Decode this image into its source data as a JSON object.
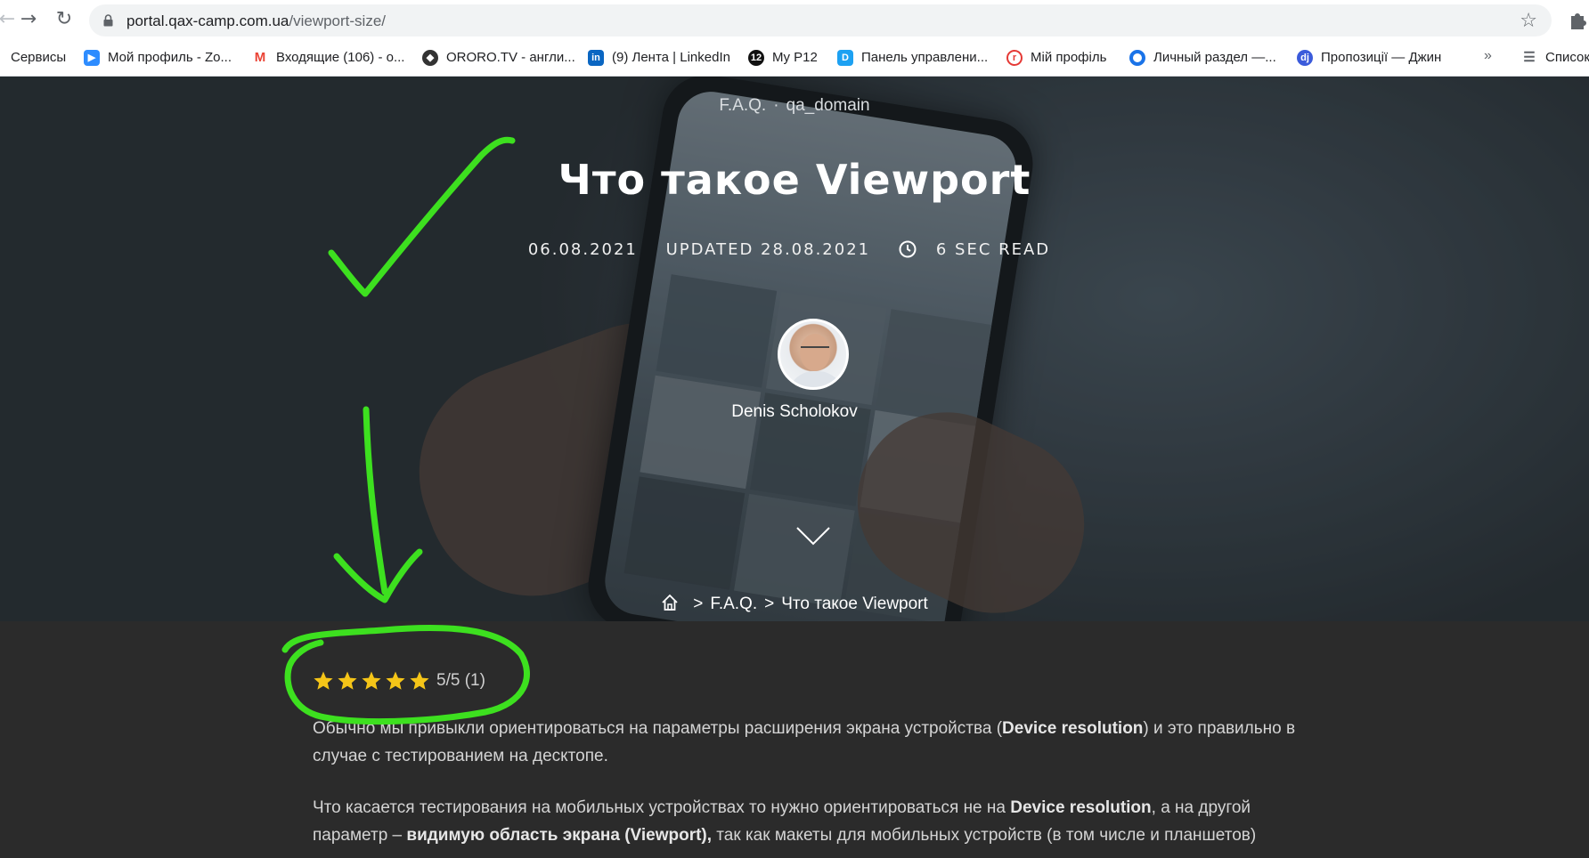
{
  "browser": {
    "url_domain": "portal.qax-camp.com.ua",
    "url_path": "/viewport-size/",
    "bookmarks": [
      {
        "label": "Сервисы",
        "icon": "apps-icon",
        "color": "#ea4335"
      },
      {
        "label": "Мой профиль - Zo...",
        "icon": "zoom-icon",
        "color": "#2d8cff"
      },
      {
        "label": "Входящие (106) - о...",
        "icon": "gmail-icon",
        "color": "#ea4335"
      },
      {
        "label": "ORORO.TV - англи...",
        "icon": "ororo-icon",
        "color": "#333333"
      },
      {
        "label": "(9) Лента | LinkedIn",
        "icon": "linkedin-icon",
        "color": "#0a66c2"
      },
      {
        "label": "My P12",
        "icon": "p12-icon",
        "color": "#111111"
      },
      {
        "label": "Панель управлени...",
        "icon": "panel-icon",
        "color": "#1da1f2"
      },
      {
        "label": "Мій профіль",
        "icon": "profile-icon",
        "color": "#e53935"
      },
      {
        "label": "Личный раздел —...",
        "icon": "section-icon",
        "color": "#1a73e8"
      },
      {
        "label": "Пропозиції — Джин",
        "icon": "djinni-icon",
        "color": "#3b5bdb"
      },
      {
        "label": "Список",
        "icon": "reading-list-icon",
        "color": "#5f6368"
      }
    ],
    "more_label": "»"
  },
  "hero": {
    "category": "F.A.Q.",
    "tag": "qa_domain",
    "title": "Что такое Viewport",
    "date": "06.08.2021",
    "updated": "UPDATED 28.08.2021",
    "read_time": "6 SEC READ",
    "author": "Denis Scholokov",
    "breadcrumb": {
      "sep": ">",
      "section": "F.A.Q.",
      "current": "Что такое Viewport"
    }
  },
  "rating": {
    "stars_filled": 5,
    "stars_total": 5,
    "text": "5/5 (1)",
    "star_color": "#f5c518"
  },
  "article": {
    "p1_a": "Обычно мы привыкли ориентироваться на параметры расширения экрана устройства (",
    "p1_b": "Device resolution",
    "p1_c": ") и это правильно в случае с тестированием на десктопе.",
    "p2_a": "Что касается тестирования на мобильных устройствах то нужно ориентироваться не на ",
    "p2_b": "Device resolution",
    "p2_c": ", а на другой параметр – ",
    "p2_d": "видимую область экрана (Viewport),",
    "p2_e": " так как макеты для мобильных устройств (в том числе и планшетов)"
  },
  "annotation_color": "#3de01f"
}
